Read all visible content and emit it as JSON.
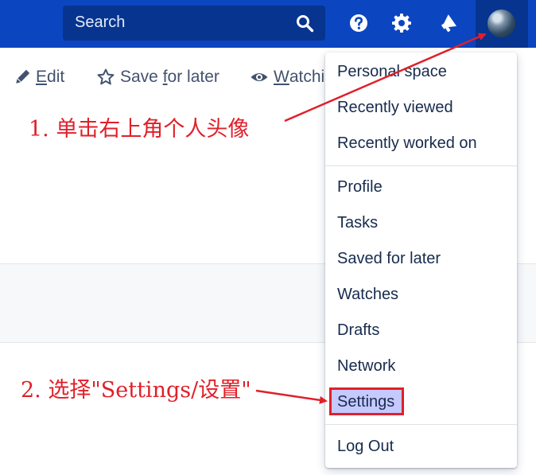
{
  "header": {
    "search_label": "Search",
    "icons": [
      "search-icon",
      "help-icon",
      "settings-gear-icon",
      "notifications-megaphone-icon"
    ]
  },
  "toolbar": {
    "edit_label": "Edit",
    "edit_mnemonic": "E",
    "edit_rest": "dit",
    "save_pre": "Save ",
    "save_mnemonic": "f",
    "save_rest": "or later",
    "watching_mnemonic": "W",
    "watching_rest": "atchin"
  },
  "user_menu": {
    "items": [
      "Personal space",
      "Recently viewed",
      "Recently worked on",
      "Profile",
      "Tasks",
      "Saved for later",
      "Watches",
      "Drafts",
      "Network",
      "Settings",
      "Log Out"
    ],
    "highlighted": "Settings"
  },
  "annotations": {
    "step1": "1. 单击右上角个人头像",
    "step2": "2. 选择\"Settings/设置\"",
    "color": "#e0202a"
  },
  "colors": {
    "header_bg": "#0b45c0",
    "search_bg": "#07348f",
    "highlight_bg": "#c5c9ff",
    "annotation_red": "#e0202a"
  }
}
